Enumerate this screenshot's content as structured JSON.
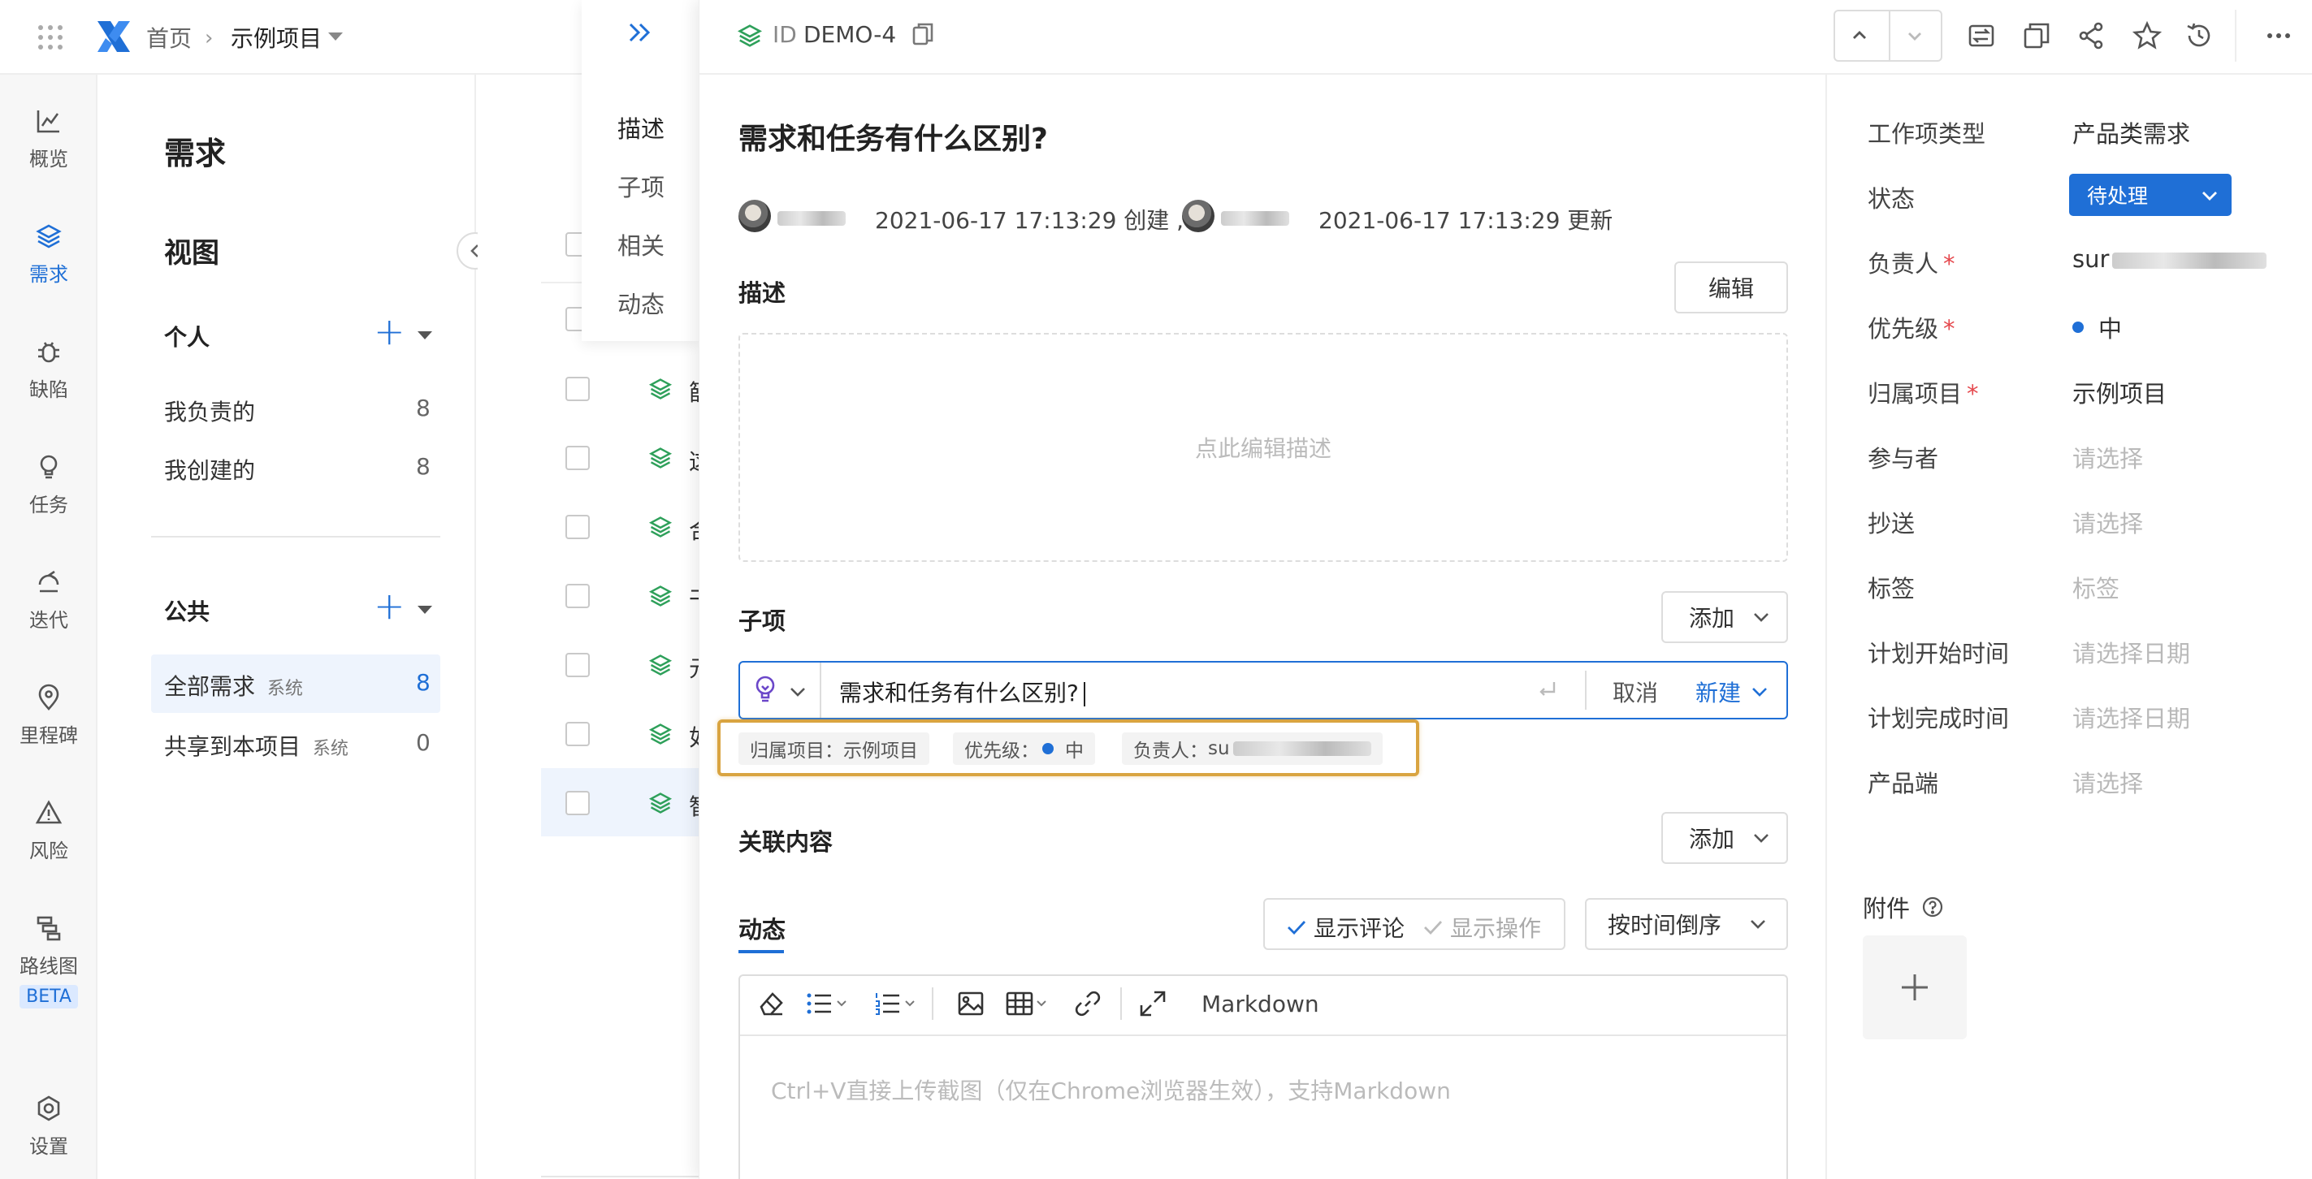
{
  "topbar": {
    "home": "首页",
    "project": "示例项目"
  },
  "leftnav": [
    {
      "icon": "chart-line-icon",
      "label": "概览"
    },
    {
      "icon": "layers-icon",
      "label": "需求"
    },
    {
      "icon": "bug-icon",
      "label": "缺陷"
    },
    {
      "icon": "lightbulb-icon",
      "label": "任务"
    },
    {
      "icon": "cycle-icon",
      "label": "迭代"
    },
    {
      "icon": "location-pin-icon",
      "label": "里程碑"
    },
    {
      "icon": "warning-triangle-icon",
      "label": "风险"
    },
    {
      "icon": "roadmap-icon",
      "label": "路线图"
    },
    {
      "icon": "settings-gear-icon",
      "label": "设置"
    }
  ],
  "leftnav_badge": "BETA",
  "views": {
    "page_title": "需求",
    "section_title": "视图",
    "personal": {
      "title": "个人",
      "items": [
        {
          "label": "我负责的",
          "count": "8"
        },
        {
          "label": "我创建的",
          "count": "8"
        }
      ]
    },
    "public": {
      "title": "公共",
      "items": [
        {
          "label": "全部需求",
          "tag": "系统",
          "count": "8"
        },
        {
          "label": "共享到本项目",
          "tag": "系统",
          "count": "0"
        }
      ]
    }
  },
  "list": {
    "row_chars": [
      "篩",
      "这",
      "合",
      "干",
      "元",
      "如",
      "智"
    ]
  },
  "section_nav": [
    "描述",
    "子项",
    "相关",
    "动态"
  ],
  "detail": {
    "id_prefix": "ID",
    "id": "DEMO-4",
    "title": "需求和任务有什么区别?",
    "created_at": "2021-06-17 17:13:29 创建 ,",
    "updated_at": "2021-06-17 17:13:29 更新",
    "user_short": "...",
    "description": {
      "heading": "描述",
      "edit_button": "编辑",
      "placeholder": "点此编辑描述"
    },
    "subitems": {
      "heading": "子项",
      "add_button": "添加",
      "input_value": "需求和任务有什么区别?",
      "cancel": "取消",
      "create": "新建",
      "chips": {
        "project_label": "归属项目：",
        "project_value": "示例项目",
        "priority_label": "优先级：",
        "priority_value": "中",
        "assignee_label": "负责人：",
        "assignee_value": "su"
      }
    },
    "related": {
      "heading": "关联内容",
      "add_button": "添加"
    },
    "activity": {
      "heading": "动态",
      "show_comments": "显示评论",
      "show_operations": "显示操作",
      "sort": "按时间倒序",
      "markdown": "Markdown",
      "editor_placeholder": "Ctrl+V直接上传截图（仅在Chrome浏览器生效），支持Markdown"
    }
  },
  "sidebar": {
    "fields": [
      {
        "label": "工作项类型",
        "value": "产品类需求"
      },
      {
        "label": "状态",
        "value": "待处理"
      },
      {
        "label": "负责人",
        "value": "sur"
      },
      {
        "label": "优先级",
        "value": "中"
      },
      {
        "label": "归属项目",
        "value": "示例项目"
      },
      {
        "label": "参与者",
        "placeholder": "请选择"
      },
      {
        "label": "抄送",
        "placeholder": "请选择"
      },
      {
        "label": "标签",
        "placeholder": "标签"
      },
      {
        "label": "计划开始时间",
        "placeholder": "请选择日期"
      },
      {
        "label": "计划完成时间",
        "placeholder": "请选择日期"
      },
      {
        "label": "产品端",
        "placeholder": "请选择"
      }
    ],
    "attachments": {
      "label": "附件"
    }
  },
  "colors": {
    "accent": "#1f6fd6",
    "status_bg": "#1f6fd6",
    "highlight": "#d9a441",
    "required": "#e5484d"
  }
}
